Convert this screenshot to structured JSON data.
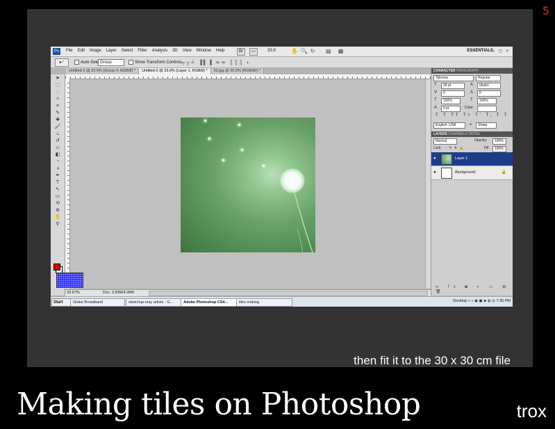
{
  "slide": {
    "number": "5",
    "caption": "then fit it to the 30 x 30 cm file",
    "title": "Making tiles on Photoshop",
    "author": "trox"
  },
  "app": {
    "logo": "Ps",
    "menu": [
      "File",
      "Edit",
      "Image",
      "Layer",
      "Select",
      "Filter",
      "Analysis",
      "3D",
      "View",
      "Window",
      "Help"
    ],
    "zoom_menu": "33.9",
    "workspace": "ESSENTIALS",
    "window_controls": "– ◻ ×"
  },
  "options": {
    "auto_select_label": "Auto-Select:",
    "auto_select_value": "Group",
    "show_transform_label": "Show Transform Controls"
  },
  "tabs": [
    "Untitled-1 @ 22.6% (Group 4, RGB/8) *",
    "Untitled-2 @ 33.9% (Layer 1, RGB/8) *",
    "53.jpg @ 25.9% (RGB/8#) *"
  ],
  "status": {
    "zoom": "33.67%",
    "doc": "Doc: 3.99M/4.08M"
  },
  "character": {
    "tab_character": "CHARACTER",
    "tab_paragraph": "PARAGRAPH",
    "font": "Tahoma",
    "style": "Regular",
    "size": "18 pt",
    "leading": "(Auto)",
    "kerning": "0",
    "tracking": "0",
    "vscale": "100%",
    "hscale": "100%",
    "baseline": "0 pt",
    "color_label": "Color:",
    "language": "English: USA",
    "aa_label": "a",
    "antialias": "Sharp"
  },
  "layers": {
    "tab_layers": "LAYERS",
    "tab_channels": "CHANNELS",
    "tab_paths": "PATHS",
    "blend": "Normal",
    "opacity_label": "Opacity:",
    "opacity": "100%",
    "lock_label": "Lock:",
    "fill_label": "Fill:",
    "fill": "100%",
    "items": [
      {
        "name": "Layer 1",
        "selected": true
      },
      {
        "name": "Background",
        "selected": false
      }
    ]
  },
  "taskbar": {
    "start": "Start",
    "items": [
      "Globe Broadband",
      "sketchup-vray artists - G...",
      "Adobe Photoshop CS4...",
      "tiles making"
    ],
    "desktop": "Desktop",
    "time": "7:35 PM"
  }
}
